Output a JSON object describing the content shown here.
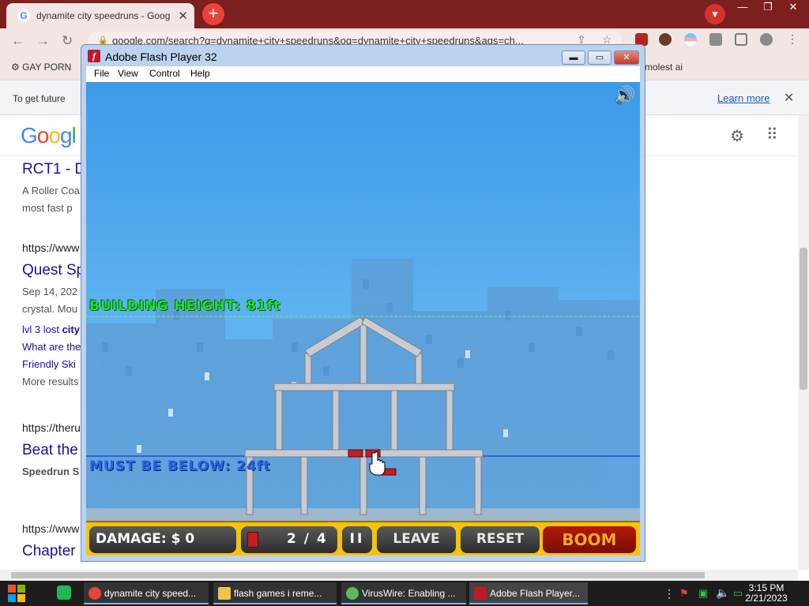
{
  "browser": {
    "tab_title": "dynamite city speedruns - Goog",
    "tab_close": "✕",
    "new_tab": "+",
    "url": "google.com/search?q=dynamite+city+speedruns&oq=dynamite+city+speedruns&aqs=ch...",
    "bookmarks": [
      "GAY PORN",
      "molest ai"
    ],
    "info_message": "To get future",
    "learn_more": "Learn more",
    "window_controls": [
      "—",
      "❐",
      "✕"
    ]
  },
  "google": {
    "logo_parts": [
      "G",
      "o",
      "o",
      "g",
      "l"
    ],
    "results": [
      {
        "title": "RCT1 - D",
        "text1": "A Roller Coa",
        "text2": "most fast p"
      },
      {
        "url": "https://www",
        "title": "Quest Sp",
        "date": "Sep 14, 202",
        "text": "crystal. Mou"
      },
      {
        "link1_a": "lvl 3 lost ",
        "link1_b": "city",
        "link2": "What are the",
        "link3": "Friendly Ski",
        "link4": "More results"
      },
      {
        "url": "https://theru",
        "title": "Beat the",
        "text": "Speedrun S"
      },
      {
        "url": "https://www",
        "title": "Chapter"
      }
    ]
  },
  "flash_player": {
    "title": "Adobe Flash Player 32",
    "menu": [
      "File",
      "View",
      "Control",
      "Help"
    ],
    "minimize": "▬",
    "maximize": "▭",
    "close": "✕"
  },
  "game": {
    "building_height_label": "BUILDING HEIGHT: 81ft",
    "must_be_below_label": "MUST BE BELOW: 24ft",
    "damage": "DAMAGE: $ 0",
    "dynamite_count": "2 / 4",
    "pause": "II",
    "leave": "LEAVE",
    "reset": "RESET",
    "boom": "BOOM",
    "speaker": "🔊"
  },
  "taskbar": {
    "tasks": [
      {
        "label": "dynamite city speed...",
        "color": "#e8433b"
      },
      {
        "label": "flash games i reme...",
        "color": "#f2c24b"
      },
      {
        "label": "VirusWire: Enabling ...",
        "color": "#5cb85c"
      },
      {
        "label": "Adobe Flash Player...",
        "color": "#c0182b"
      }
    ],
    "time": "3:15 PM",
    "date": "2/21/2023"
  },
  "colors": {
    "chrome_frame": "#7b1f1f",
    "sky": "#5bb0ef",
    "hud_yellow": "#f5c20e",
    "height_green": "#1ee02c",
    "below_blue": "#2a62e6",
    "dynamite_red": "#c11e1e"
  }
}
